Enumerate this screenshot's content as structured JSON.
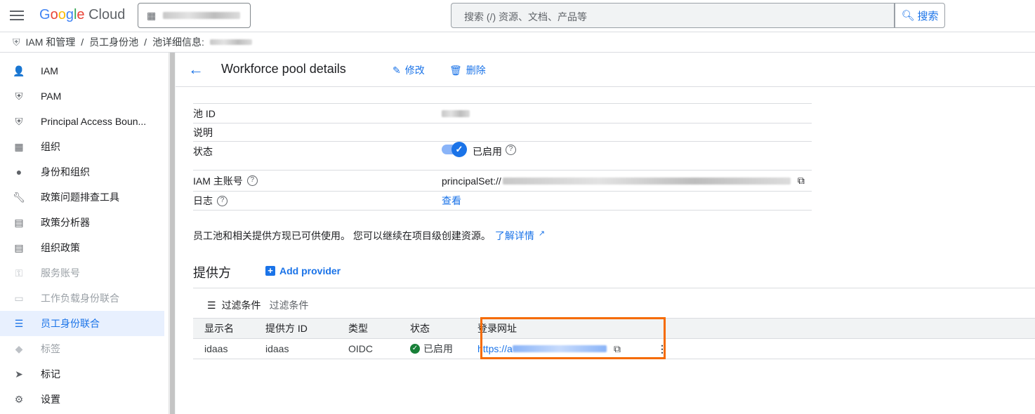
{
  "header": {
    "logo": "Google Cloud",
    "project": "",
    "search_placeholder": "搜索 (/) 资源、文档、产品等",
    "search_button": "搜索"
  },
  "breadcrumb": [
    "IAM 和管理",
    "员工身份池",
    "池详细信息:"
  ],
  "sidebar": {
    "items": [
      {
        "label": "IAM",
        "icon": "person-add-icon"
      },
      {
        "label": "PAM",
        "icon": "shield-icon"
      },
      {
        "label": "Principal Access Boun...",
        "icon": "shield-gear-icon"
      },
      {
        "label": "组织",
        "icon": "building-icon"
      },
      {
        "label": "身份和组织",
        "icon": "account-circle-icon"
      },
      {
        "label": "政策问题排查工具",
        "icon": "wrench-icon"
      },
      {
        "label": "政策分析器",
        "icon": "document-search-icon"
      },
      {
        "label": "组织政策",
        "icon": "list-alt-icon"
      },
      {
        "label": "服务账号",
        "icon": "key-icon"
      },
      {
        "label": "工作负载身份联合",
        "icon": "id-card-icon"
      },
      {
        "label": "员工身份联合",
        "icon": "list-icon"
      },
      {
        "label": "标签",
        "icon": "tag-icon"
      },
      {
        "label": "标记",
        "icon": "label-icon"
      },
      {
        "label": "设置",
        "icon": "gear-icon"
      }
    ]
  },
  "page": {
    "title": "Workforce pool details",
    "edit": "修改",
    "delete": "删除"
  },
  "details": {
    "pool_id_label": "池 ID",
    "desc_label": "说明",
    "state_label": "状态",
    "state_value": "已启用",
    "principal_label": "IAM 主账号",
    "principal_value": "principalSet://",
    "log_label": "日志",
    "log_link": "查看"
  },
  "info": {
    "text": "员工池和相关提供方现已可供使用。 您可以继续在项目级创建资源。",
    "link": "了解详情"
  },
  "providers": {
    "title": "提供方",
    "add": "Add provider",
    "filter_label": "过滤条件",
    "filter_placeholder": "过滤条件",
    "columns": [
      "显示名",
      "提供方 ID",
      "类型",
      "状态",
      "登录网址"
    ],
    "rows": [
      {
        "name": "idaas",
        "id": "idaas",
        "type": "OIDC",
        "status": "已启用",
        "url": "https://a"
      }
    ]
  },
  "colors": {
    "accent": "#1a73e8",
    "highlight": "#f56b00",
    "success": "#188038"
  }
}
